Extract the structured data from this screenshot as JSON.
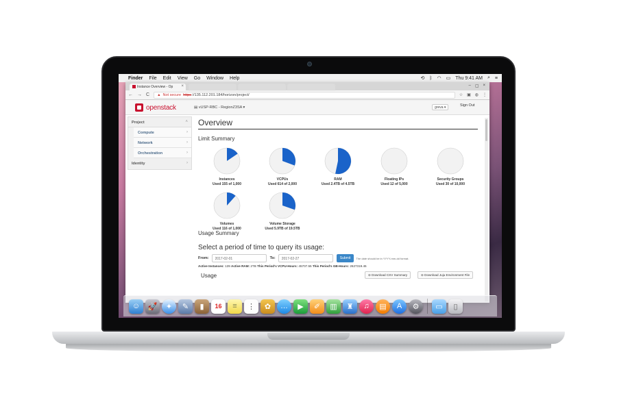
{
  "menubar": {
    "items": [
      "Finder",
      "File",
      "Edit",
      "View",
      "Go",
      "Window",
      "Help"
    ],
    "clock": "Thu 9:41 AM"
  },
  "browser": {
    "active_tab": "Instance Overview - Op",
    "url_warning": "Not secure",
    "url_scheme": "https",
    "url_rest": "://135.112.201.184/horizon/project/"
  },
  "header": {
    "logo": "openstack",
    "project_selector": "vUSP-RBC - RegionZ3SA",
    "user": "greva",
    "sign_out": "Sign Out"
  },
  "sidebar": {
    "project": "Project",
    "items": [
      "Compute",
      "Network",
      "Orchestration"
    ],
    "identity": "Identity"
  },
  "overview": {
    "title": "Overview",
    "limit_summary": "Limit Summary",
    "limits": [
      {
        "label": "Instances",
        "used": "Used 155 of 1,000",
        "fraction": 0.155
      },
      {
        "label": "VCPUs",
        "used": "Used 614 of 2,000",
        "fraction": 0.307
      },
      {
        "label": "RAM",
        "used": "Used 2.4TB of 4.5TB",
        "fraction": 0.533
      },
      {
        "label": "Floating IPs",
        "used": "Used 12 of 5,000",
        "fraction": 0.0024
      },
      {
        "label": "Security Groups",
        "used": "Used 30 of 10,000",
        "fraction": 0.003
      },
      {
        "label": "Volumes",
        "used": "Used 116 of 1,000",
        "fraction": 0.116
      },
      {
        "label": "Volume Storage",
        "used": "Used 5.9TB of 19.5TB",
        "fraction": 0.303
      }
    ],
    "usage_summary": "Usage Summary",
    "period_heading": "Select a period of time to query its usage:",
    "from_label": "From:",
    "from_value": "2017-02-01",
    "to_label": "To:",
    "to_value": "2017-02-27",
    "submit": "Submit",
    "date_hint": "The date should be in YYYY-mm-dd format.",
    "active_instances_label": "Active Instances:",
    "active_instances": "139",
    "active_ram_label": "Active RAM:",
    "active_ram": "2TB",
    "vcpu_hours_label": "This Period's VCPU-Hours:",
    "vcpu_hours": "45707.55",
    "gb_hours_label": "This Period's GB-Hours:",
    "gb_hours": "2627319.45",
    "usage": "Usage",
    "download_csv": "Download CSV Summary",
    "download_juju": "Download Juju Environment File"
  },
  "colors": {
    "accent": "#1a63c9",
    "brand": "#c8102e",
    "pie_empty": "#f2f2f2"
  },
  "dock": {
    "icons": [
      "finder-icon",
      "launchpad-icon",
      "safari-icon",
      "photo-preview-icon",
      "contacts-icon",
      "calendar-icon",
      "notes-icon",
      "reminders-icon",
      "photos-icon",
      "messages-icon",
      "facetime-icon",
      "pages-icon",
      "numbers-icon",
      "keynote-icon",
      "itunes-icon",
      "ibooks-icon",
      "app-store-icon",
      "system-preferences-icon",
      "downloads-folder-icon",
      "trash-icon"
    ],
    "calendar_day": "16"
  }
}
